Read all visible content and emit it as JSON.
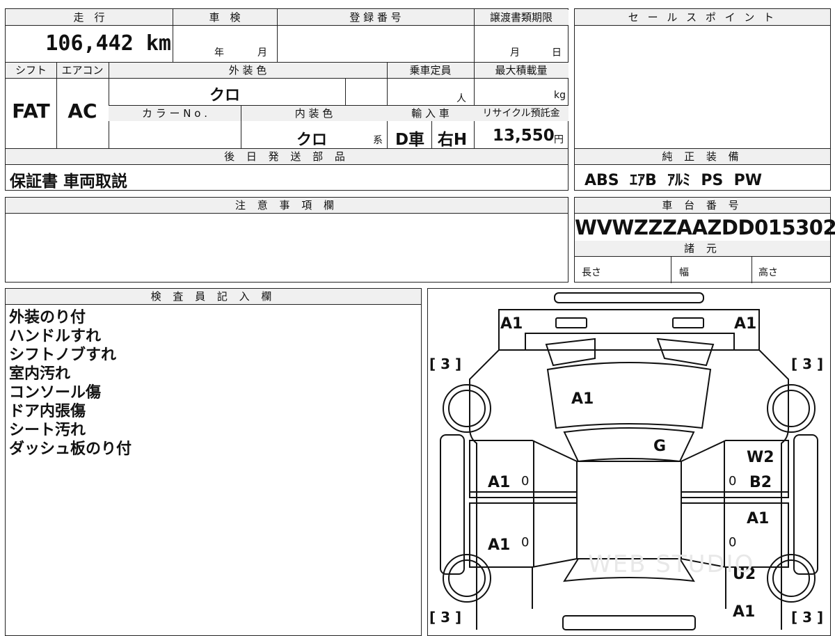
{
  "left_table": {
    "mileage_label": "走　行",
    "mileage_value": "106,442 km",
    "inspection_label": "車　検",
    "inspection_year": "年",
    "inspection_month": "月",
    "reg_number_label": "登 録 番 号",
    "transfer_deadline_label": "譲渡書類期限",
    "transfer_month": "月",
    "transfer_day": "日",
    "shift_label": "シフト",
    "aircon_label": "エアコン",
    "exterior_color_label": "外 装 色",
    "capacity_label": "乗車定員",
    "max_load_label": "最大積載量",
    "shift_value": "FAT",
    "aircon_value": "AC",
    "exterior_color_value": "クロ",
    "capacity_unit": "人",
    "max_load_unit": "kg",
    "color_no_label": "カ ラ ー N o .",
    "interior_color_label": "内 装 色",
    "import_label": "輸 入 車",
    "recycle_label": "リサイクル預託金",
    "interior_color_value": "クロ",
    "interior_color_suffix": "系",
    "import_value_1": "D車",
    "import_value_2": "右H",
    "recycle_value": "13,550",
    "recycle_unit": "円",
    "later_parts_label": "後 日 発 送 部 品",
    "later_parts_value": "保証書 車両取説"
  },
  "sales_point": {
    "label": "セ ー ル ス ポ イ ン ト",
    "equipment_label": "純 正 装 備",
    "equipment_value": "ABS  ｴｱB  ｱﾙﾐ  PS  PW"
  },
  "caution": {
    "label": "注 意 事 項 欄"
  },
  "chassis": {
    "label": "車 台 番 号",
    "value": "WVWZZZAAZDD015302",
    "spec_label": "諸 元",
    "length_label": "長さ",
    "width_label": "幅",
    "height_label": "高さ"
  },
  "inspector": {
    "label": "検 査 員 記 入 欄",
    "notes": [
      "外装のり付",
      "ハンドルすれ",
      "シフトノブすれ",
      "室内汚れ",
      "コンソール傷",
      "ドア内張傷",
      "シート汚れ",
      "ダッシュ板のり付"
    ]
  },
  "diagram": {
    "marks": {
      "top_left": "A1",
      "top_right": "A1",
      "hood": "A1",
      "windshield": "G",
      "front_left_door": "A1",
      "rear_left_door": "A1",
      "front_right_upper": "W2",
      "front_right_lower": "B2",
      "rear_right_upper": "A1",
      "rear_right_wheel": "U2",
      "rear_right_bottom": "A1",
      "tire_fl": "[ 3 ]",
      "tire_fr": "[ 3 ]",
      "tire_rl": "[ 3 ]",
      "tire_rr": "[ 3 ]",
      "zero": "0"
    },
    "watermark": "WEB STUDIO"
  }
}
